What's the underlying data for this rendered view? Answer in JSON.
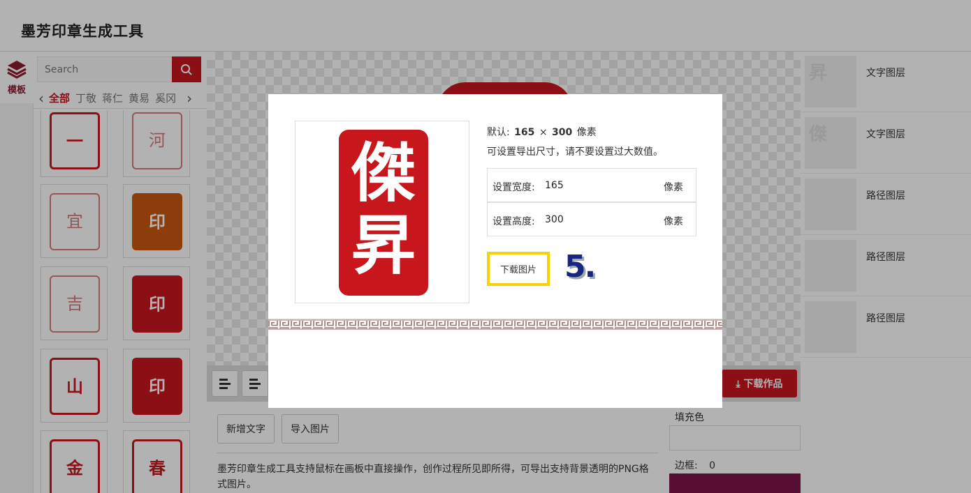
{
  "app": {
    "title": "墨芳印章生成工具"
  },
  "left_rail": {
    "tab_label": "模板"
  },
  "templates_panel": {
    "search_placeholder": "Search",
    "categories": [
      "全部",
      "丁敬",
      "蒋仁",
      "黄易",
      "奚冈"
    ],
    "prev_arrow": "‹",
    "next_arrow": "›",
    "items": [
      {
        "style": "outline",
        "text": "一"
      },
      {
        "style": "outline2",
        "text": "河"
      },
      {
        "style": "outline2",
        "text": "宜"
      },
      {
        "style": "orange",
        "text": "印"
      },
      {
        "style": "outline2",
        "text": "吉"
      },
      {
        "style": "solid",
        "text": "印"
      },
      {
        "style": "outline",
        "text": "山"
      },
      {
        "style": "solid",
        "text": "印"
      },
      {
        "style": "outline",
        "text": "金"
      },
      {
        "style": "outline",
        "text": "春"
      }
    ]
  },
  "toolbar": {
    "download_work_label": "下载作品",
    "download_icon": "download-icon"
  },
  "bottom": {
    "add_text_label": "新增文字",
    "import_image_label": "导入图片",
    "description": "墨芳印章生成工具支持鼠标在画板中直接操作，创作过程所见即所得，可导出支持背景透明的PNG格式图片。"
  },
  "layers_panel": {
    "layers": [
      {
        "name": "文字图层",
        "glyph": "昇"
      },
      {
        "name": "文字图层",
        "glyph": "傑"
      },
      {
        "name": "路径图层",
        "glyph": ""
      },
      {
        "name": "路径图层",
        "glyph": ""
      },
      {
        "name": "路径图层",
        "glyph": ""
      }
    ]
  },
  "properties": {
    "fill_label": "填充色",
    "border_label": "边框:",
    "border_value": "0",
    "border_color": "#7e1448"
  },
  "modal": {
    "preview_chars": [
      "傑",
      "昇"
    ],
    "default_label": "默认:",
    "default_width": "165",
    "times": "×",
    "default_height": "300",
    "pixel_unit": "像素",
    "hint": "可设置导出尺寸，请不要设置过大数值。",
    "width_label": "设置宽度:",
    "width_value": "165",
    "height_label": "设置高度:",
    "height_value": "300",
    "download_image_label": "下载图片",
    "step_label": "5."
  },
  "colors": {
    "brand_red": "#c8161d",
    "highlight_yellow": "#f5d400",
    "step_blue": "#1a2580"
  }
}
